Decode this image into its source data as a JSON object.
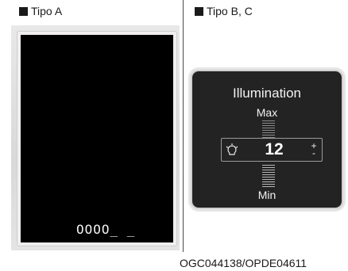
{
  "panels": {
    "a": {
      "label": "Tipo A",
      "odometer": "OOOO_ _"
    },
    "b": {
      "label": "Tipo B, C",
      "title": "Illumination",
      "max_label": "Max",
      "min_label": "Min",
      "level": "12",
      "plus_minus": [
        "+",
        "-"
      ]
    }
  },
  "caption": "OGC044138/OPDE04611"
}
